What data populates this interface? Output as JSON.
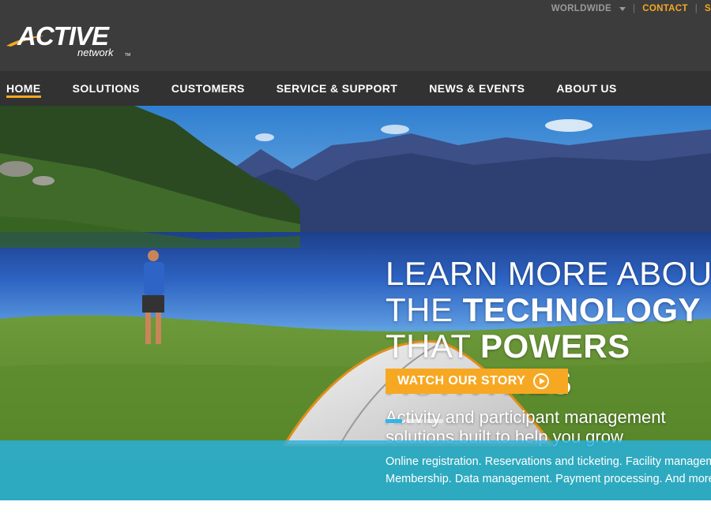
{
  "utility_bar": {
    "region_label": "WORLDWIDE",
    "separator": "|",
    "contact_label": "CONTACT",
    "trailing_label": "S"
  },
  "logo": {
    "wordmark": "ACTIVE",
    "tagline": "network",
    "trademark": "TM"
  },
  "nav": {
    "items": [
      {
        "label": "HOME",
        "active": true
      },
      {
        "label": "SOLUTIONS",
        "active": false
      },
      {
        "label": "CUSTOMERS",
        "active": false
      },
      {
        "label": "SERVICE & SUPPORT",
        "active": false
      },
      {
        "label": "NEWS & EVENTS",
        "active": false
      },
      {
        "label": "ABOUT US",
        "active": false
      }
    ]
  },
  "hero": {
    "headline": {
      "line1": "LEARN MORE ABOUT",
      "line2_light": "THE ",
      "line2_bold": "TECHNOLOGY",
      "line3_light": "THAT ",
      "line3_bold": "POWERS",
      "line4_bold": "ACTIVITIES"
    },
    "subhead": {
      "line1": "Activity and participant management",
      "line2": "solutions built to help you grow"
    },
    "cta_label": "WATCH OUR STORY",
    "cta_icon": "play-circle-icon",
    "slider": {
      "slide_count": 3,
      "active_index": 0
    }
  },
  "band": {
    "line1": "Online registration. Reservations and ticketing. Facility management.",
    "line2": "Membership. Data management. Payment processing. And more."
  },
  "colors": {
    "header_bg": "#3c3c3c",
    "nav_bg": "#323232",
    "accent": "#f7a823",
    "band": "#26b2e2"
  }
}
